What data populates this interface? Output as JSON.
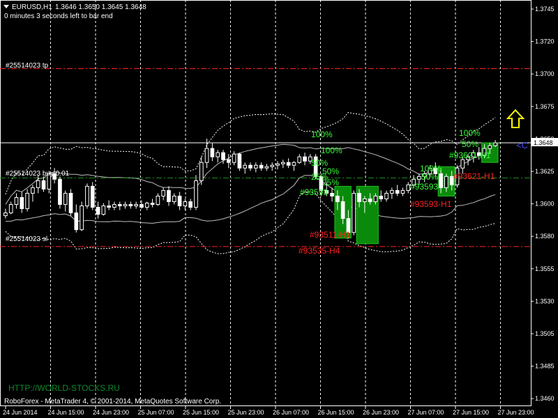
{
  "header": {
    "symbol": "EURUSD,H1",
    "ohlc": "1.3646 1.3650 1.3645 1.3648",
    "countdown": "0 minutes 3 seconds left to bar end"
  },
  "orders": {
    "tp_label": "#25514023 tp",
    "buy_label": "#25514023 buy 0.01",
    "sl_label": "#25514023 sl",
    "tp_price": 1.3701,
    "buy_price": 1.3623,
    "sl_price": 1.3574,
    "tp_color": "#ff2020",
    "buy_color": "#1f8f1f",
    "sl_color": "#ff2020"
  },
  "current_price": {
    "value": 1.3648,
    "label": "1.3648"
  },
  "indicator_labels": {
    "zones_a": [
      "100%",
      "100%",
      "50%",
      "50%",
      "25%",
      "25%"
    ],
    "zone_a_tag": "#93535-H4",
    "zone_a_tag2": "#93511-H1",
    "zone_b_overlap": "#93593",
    "zones_b": [
      "100%",
      "100%",
      "50%",
      "50%"
    ],
    "zone_b_tag": "#93593-H1",
    "zone_c_tag": "#93621-H1",
    "zone_c_overlap": "#93621-H1",
    "cut_label": "<C"
  },
  "footer": {
    "watermark": "HTTP://WORLD-STOCKS.RU",
    "copyright": "RoboForex - MetaTrader 4, © 2001-2014, MetaQuotes Software Corp."
  },
  "colors": {
    "background": "#000000",
    "bull_candle": "#ffffff",
    "bear_candle": "#ffffff",
    "zone_fill": "#0a8a0a",
    "band_outer": "#ffffff",
    "band_inner": "#b0b0b0",
    "grid": "#ffffff",
    "arrow": "#ffff00"
  },
  "chart_data": {
    "type": "candlestick",
    "title": "EURUSD,H1",
    "ylim": [
      1.346,
      1.375
    ],
    "y_ticks": [
      "1.3745",
      "1.3720",
      "1.3700",
      "1.3675",
      "1.3650",
      "1.3625",
      "1.3600",
      "1.3580",
      "1.3555",
      "1.3530",
      "1.3505",
      "1.3485",
      "1.3460"
    ],
    "x_ticks": [
      "24 Jun 2014",
      "24 Jun 15:00",
      "24 Jun 23:00",
      "25 Jun 07:00",
      "25 Jun 15:00",
      "25 Jun 23:00",
      "26 Jun 07:00",
      "26 Jun 15:00",
      "26 Jun 23:00",
      "27 Jun 07:00",
      "27 Jun 15:00",
      "27 Jun 23:00"
    ],
    "grid": true,
    "candles_ohlc": [
      [
        1.3596,
        1.3601,
        1.3594,
        1.3598
      ],
      [
        1.3598,
        1.3606,
        1.3597,
        1.3604
      ],
      [
        1.3604,
        1.3612,
        1.3601,
        1.3609
      ],
      [
        1.3609,
        1.3613,
        1.3598,
        1.3601
      ],
      [
        1.3601,
        1.3615,
        1.3599,
        1.3612
      ],
      [
        1.3612,
        1.3618,
        1.3606,
        1.3616
      ],
      [
        1.3616,
        1.3625,
        1.3612,
        1.3621
      ],
      [
        1.3621,
        1.3624,
        1.3613,
        1.3615
      ],
      [
        1.3615,
        1.3628,
        1.3612,
        1.3626
      ],
      [
        1.3626,
        1.363,
        1.3619,
        1.3622
      ],
      [
        1.3622,
        1.3624,
        1.3601,
        1.3604
      ],
      [
        1.3604,
        1.3614,
        1.3599,
        1.3612
      ],
      [
        1.3612,
        1.3615,
        1.3596,
        1.3598
      ],
      [
        1.3598,
        1.3604,
        1.3584,
        1.3586
      ],
      [
        1.3586,
        1.3606,
        1.3585,
        1.3603
      ],
      [
        1.3603,
        1.3619,
        1.3601,
        1.3617
      ],
      [
        1.3617,
        1.362,
        1.36,
        1.3602
      ],
      [
        1.3602,
        1.3606,
        1.3594,
        1.3597
      ],
      [
        1.3597,
        1.3605,
        1.3596,
        1.3603
      ],
      [
        1.3603,
        1.3607,
        1.36,
        1.3602
      ],
      [
        1.3602,
        1.3606,
        1.36,
        1.3604
      ],
      [
        1.3604,
        1.3606,
        1.36,
        1.3603
      ],
      [
        1.3603,
        1.3606,
        1.3601,
        1.3604
      ],
      [
        1.3604,
        1.3606,
        1.3601,
        1.3603
      ],
      [
        1.3603,
        1.3606,
        1.3601,
        1.3604
      ],
      [
        1.3604,
        1.3607,
        1.3601,
        1.3602
      ],
      [
        1.3602,
        1.3606,
        1.36,
        1.3605
      ],
      [
        1.3605,
        1.3608,
        1.3602,
        1.3604
      ],
      [
        1.3604,
        1.3612,
        1.3603,
        1.361
      ],
      [
        1.361,
        1.3616,
        1.3607,
        1.3614
      ],
      [
        1.3614,
        1.3617,
        1.3603,
        1.3606
      ],
      [
        1.3606,
        1.3612,
        1.3604,
        1.361
      ],
      [
        1.361,
        1.3613,
        1.36,
        1.3603
      ],
      [
        1.3603,
        1.3608,
        1.36,
        1.3606
      ],
      [
        1.3606,
        1.3608,
        1.36,
        1.3602
      ],
      [
        1.3602,
        1.3625,
        1.36,
        1.3621
      ],
      [
        1.3621,
        1.3638,
        1.3618,
        1.3634
      ],
      [
        1.3634,
        1.3651,
        1.363,
        1.3644
      ],
      [
        1.3644,
        1.3648,
        1.3635,
        1.3638
      ],
      [
        1.3638,
        1.3643,
        1.3634,
        1.3641
      ],
      [
        1.3641,
        1.3643,
        1.3633,
        1.3636
      ],
      [
        1.3636,
        1.364,
        1.363,
        1.3634
      ],
      [
        1.3634,
        1.3642,
        1.3632,
        1.364
      ],
      [
        1.364,
        1.3641,
        1.3628,
        1.363
      ],
      [
        1.363,
        1.3634,
        1.3626,
        1.3632
      ],
      [
        1.3632,
        1.3634,
        1.3628,
        1.363
      ],
      [
        1.363,
        1.3634,
        1.3627,
        1.3632
      ],
      [
        1.3632,
        1.3634,
        1.3628,
        1.363
      ],
      [
        1.363,
        1.3633,
        1.3628,
        1.3631
      ],
      [
        1.3631,
        1.3634,
        1.3628,
        1.3632
      ],
      [
        1.3632,
        1.3635,
        1.3629,
        1.3633
      ],
      [
        1.3633,
        1.3636,
        1.363,
        1.3634
      ],
      [
        1.3634,
        1.3637,
        1.363,
        1.3632
      ],
      [
        1.3632,
        1.3635,
        1.3628,
        1.3634
      ],
      [
        1.3634,
        1.364,
        1.3633,
        1.3638
      ],
      [
        1.3638,
        1.3641,
        1.3632,
        1.3635
      ],
      [
        1.3635,
        1.364,
        1.3633,
        1.3638
      ],
      [
        1.3638,
        1.364,
        1.3622,
        1.3624
      ],
      [
        1.3624,
        1.3626,
        1.361,
        1.3614
      ],
      [
        1.3614,
        1.362,
        1.361,
        1.3612
      ],
      [
        1.3612,
        1.3616,
        1.3606,
        1.361
      ],
      [
        1.361,
        1.3614,
        1.36,
        1.3606
      ],
      [
        1.3606,
        1.361,
        1.359,
        1.3594
      ],
      [
        1.3594,
        1.36,
        1.358,
        1.3584
      ],
      [
        1.3584,
        1.3614,
        1.3582,
        1.3612
      ],
      [
        1.3612,
        1.3615,
        1.3602,
        1.3606
      ],
      [
        1.3606,
        1.361,
        1.3598,
        1.3608
      ],
      [
        1.3608,
        1.3612,
        1.3604,
        1.3606
      ],
      [
        1.3606,
        1.3612,
        1.3604,
        1.361
      ],
      [
        1.361,
        1.3614,
        1.3606,
        1.3608
      ],
      [
        1.3608,
        1.3614,
        1.3606,
        1.3612
      ],
      [
        1.3612,
        1.3616,
        1.3608,
        1.3614
      ],
      [
        1.3614,
        1.3618,
        1.361,
        1.3612
      ],
      [
        1.3612,
        1.3616,
        1.361,
        1.3614
      ],
      [
        1.3614,
        1.362,
        1.3612,
        1.3618
      ],
      [
        1.3618,
        1.3625,
        1.3616,
        1.3622
      ],
      [
        1.3622,
        1.3626,
        1.3618,
        1.3624
      ],
      [
        1.3624,
        1.3628,
        1.362,
        1.3626
      ],
      [
        1.3626,
        1.3632,
        1.3623,
        1.363
      ],
      [
        1.363,
        1.3634,
        1.3624,
        1.3626
      ],
      [
        1.3626,
        1.363,
        1.3612,
        1.3616
      ],
      [
        1.3616,
        1.3626,
        1.3613,
        1.3624
      ],
      [
        1.3624,
        1.3628,
        1.3614,
        1.3618
      ],
      [
        1.3618,
        1.3632,
        1.3616,
        1.363
      ],
      [
        1.363,
        1.3638,
        1.3626,
        1.3636
      ],
      [
        1.3636,
        1.364,
        1.3632,
        1.3638
      ],
      [
        1.3638,
        1.3643,
        1.3634,
        1.3641
      ],
      [
        1.3641,
        1.3645,
        1.3636,
        1.3639
      ],
      [
        1.3639,
        1.3647,
        1.3637,
        1.3644
      ],
      [
        1.3644,
        1.3648,
        1.364,
        1.3646
      ],
      [
        1.3646,
        1.365,
        1.3645,
        1.3648
      ]
    ],
    "zones": [
      {
        "from_bar": 61,
        "to_bar": 63,
        "top": 1.3617,
        "bottom": 1.358,
        "color": "#0a8a0a"
      },
      {
        "from_bar": 65,
        "to_bar": 68,
        "top": 1.3617,
        "bottom": 1.3576,
        "color": "#0a8a0a"
      },
      {
        "from_bar": 80,
        "to_bar": 82,
        "top": 1.3631,
        "bottom": 1.361,
        "color": "#0a8a0a"
      },
      {
        "from_bar": 88,
        "to_bar": 90,
        "top": 1.3648,
        "bottom": 1.3634,
        "color": "#0a8a0a"
      }
    ]
  }
}
